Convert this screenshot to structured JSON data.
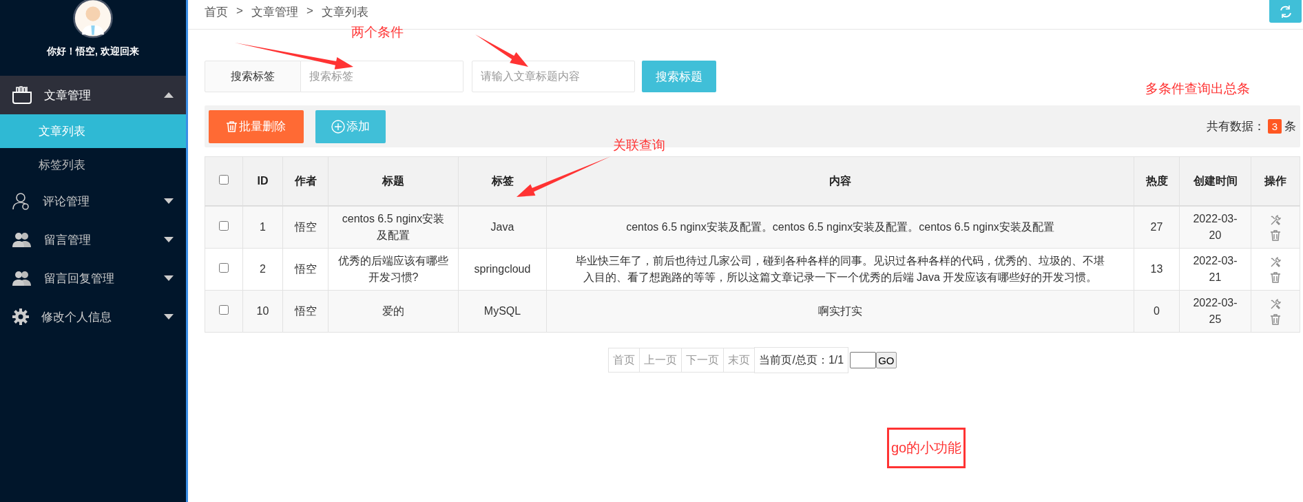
{
  "sidebar": {
    "greeting": "你好！悟空, 欢迎回来",
    "menu": [
      {
        "label": "文章管理",
        "expanded": true,
        "children": [
          {
            "label": "文章列表",
            "selected": true
          },
          {
            "label": "标签列表",
            "selected": false
          }
        ]
      },
      {
        "label": "评论管理",
        "expanded": false
      },
      {
        "label": "留言管理",
        "expanded": false
      },
      {
        "label": "留言回复管理",
        "expanded": false
      },
      {
        "label": "修改个人信息",
        "expanded": false
      }
    ]
  },
  "breadcrumb": {
    "separator": ">",
    "items": [
      "首页",
      "文章管理",
      "文章列表"
    ]
  },
  "search": {
    "label": "搜索标签",
    "fields": [
      {
        "placeholder": "搜索标签"
      },
      {
        "placeholder": "请输入文章标题内容"
      }
    ],
    "button": "搜索标题"
  },
  "toolbar": {
    "delete_button": "批量删除",
    "add_button": "添加",
    "total_label": "共有数据：",
    "total_count": "3",
    "total_unit": "条"
  },
  "table": {
    "select_all_checked": false,
    "columns": [
      "ID",
      "作者",
      "标题",
      "标签",
      "内容",
      "热度",
      "创建时间",
      "操作"
    ],
    "rows": [
      {
        "checked": false,
        "cells": [
          "1",
          "悟空",
          "centos 6.5 nginx安装及配置",
          "Java",
          "centos 6.5 nginx安装及配置。centos 6.5 nginx安装及配置。centos 6.5 nginx安装及配置",
          "27",
          "2022-03-20"
        ]
      },
      {
        "checked": false,
        "cells": [
          "2",
          "悟空",
          "优秀的后端应该有哪些开发习惯?",
          "springcloud",
          "毕业快三年了，前后也待过几家公司，碰到各种各样的同事。见识过各种各样的代码，优秀的、垃圾的、不堪入目的、看了想跑路的等等，所以这篇文章记录一下一个优秀的后端 Java 开发应该有哪些好的开发习惯。",
          "13",
          "2022-03-21"
        ]
      },
      {
        "checked": false,
        "cells": [
          "10",
          "悟空",
          "爱的",
          "MySQL",
          "啊实打实",
          "0",
          "2022-03-25"
        ]
      }
    ]
  },
  "pagination": {
    "links": [
      {
        "label": "首页",
        "disabled": true
      },
      {
        "label": "上一页",
        "disabled": true
      },
      {
        "label": "下一页",
        "disabled": true
      },
      {
        "label": "末页",
        "disabled": true
      }
    ],
    "status": "当前页/总页：1/1",
    "go_button": "GO"
  },
  "annotations": [
    {
      "kind": "note",
      "text": "两个条件"
    },
    {
      "kind": "note",
      "text": "多条件查询出总条"
    },
    {
      "kind": "note",
      "text": "关联查询"
    },
    {
      "kind": "boxed",
      "text": "go的小功能"
    }
  ]
}
